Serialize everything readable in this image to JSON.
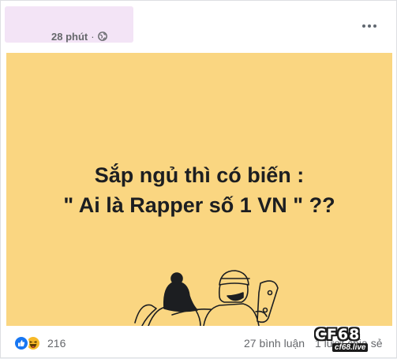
{
  "post": {
    "timestamp": "28 phút",
    "separator": "·",
    "privacy_icon": "globe-icon",
    "more_icon": "more-horizontal-icon"
  },
  "image": {
    "caption_line1": "Sắp ngủ thì có biến :",
    "caption_line2": "\" Ai là Rapper số 1 VN \" ??",
    "background_color": "#fad681"
  },
  "footer": {
    "reaction_icons": [
      "like-icon",
      "haha-icon"
    ],
    "reaction_count": "216",
    "comments": "27 bình luận",
    "shares": "1 lượt chia sẻ"
  },
  "watermark": {
    "logo_text": "CF68",
    "site": "cf68.live"
  }
}
